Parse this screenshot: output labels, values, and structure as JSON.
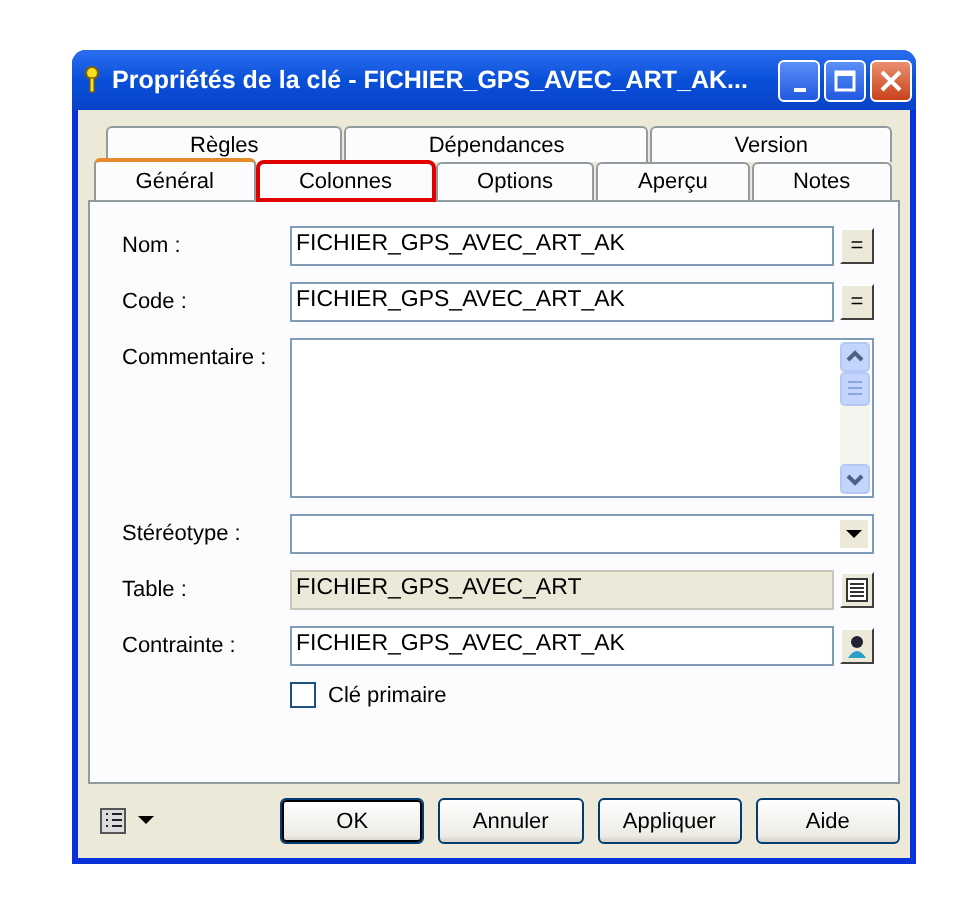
{
  "window": {
    "title": "Propriétés de la clé - FICHIER_GPS_AVEC_ART_AK...",
    "controls": [
      {
        "kind": "minimize"
      },
      {
        "kind": "maximize"
      },
      {
        "kind": "close"
      }
    ]
  },
  "tab_rows": [
    {
      "tabs": [
        {
          "label": "Règles",
          "selected": false,
          "highlighted": false
        },
        {
          "label": "Dépendances",
          "selected": false,
          "highlighted": false
        },
        {
          "label": "Version",
          "selected": false,
          "highlighted": false
        }
      ]
    },
    {
      "tabs": [
        {
          "label": "Général",
          "selected": true,
          "highlighted": false
        },
        {
          "label": "Colonnes",
          "selected": false,
          "highlighted": true
        },
        {
          "label": "Options",
          "selected": false,
          "highlighted": false
        },
        {
          "label": "Aperçu",
          "selected": false,
          "highlighted": false
        },
        {
          "label": "Notes",
          "selected": false,
          "highlighted": false
        }
      ]
    }
  ],
  "fields": [
    {
      "kind": "text",
      "label": "Nom :",
      "value": "FICHIER_GPS_AVEC_ART_AK",
      "button": {
        "kind": "text",
        "label": "="
      }
    },
    {
      "kind": "text",
      "label": "Code :",
      "value": "FICHIER_GPS_AVEC_ART_AK",
      "button": {
        "kind": "text",
        "label": "="
      }
    },
    {
      "kind": "textarea",
      "label": "Commentaire :"
    },
    {
      "kind": "dropdown",
      "label": "Stéréotype :"
    },
    {
      "kind": "readonly",
      "label": "Table :",
      "value": "FICHIER_GPS_AVEC_ART",
      "button": {
        "kind": "properties"
      }
    },
    {
      "kind": "text",
      "label": "Contrainte :",
      "value": "FICHIER_GPS_AVEC_ART_AK",
      "button": {
        "kind": "finder"
      }
    }
  ],
  "checkbox": {
    "label": "Clé primaire",
    "checked": false
  },
  "buttons": [
    {
      "label": "OK",
      "default": true
    },
    {
      "label": "Annuler",
      "default": false
    },
    {
      "label": "Appliquer",
      "default": false
    },
    {
      "label": "Aide",
      "default": false
    }
  ]
}
